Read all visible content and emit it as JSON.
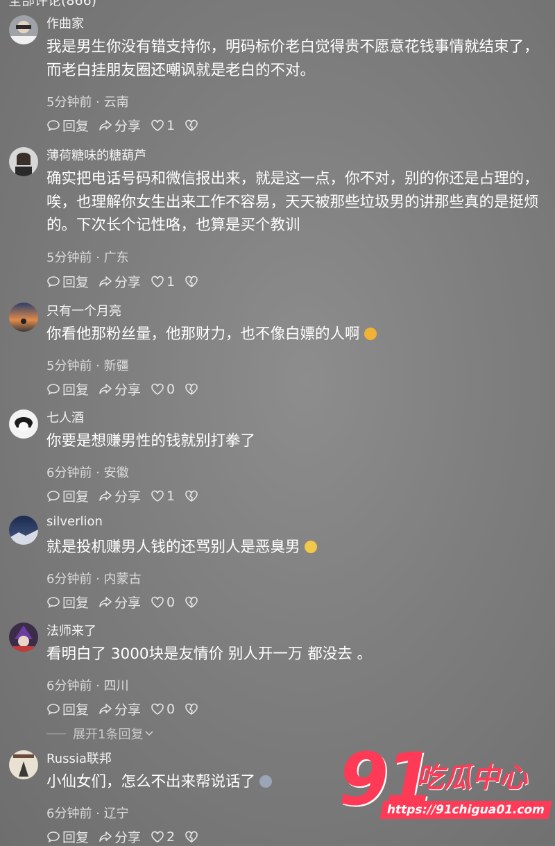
{
  "header_partial": "全部评论(866)",
  "comments": [
    {
      "username": "作曲家",
      "text": "我是男生你没有错支持你，明码标价老白觉得贵不愿意花钱事情就结束了，而老白挂朋友圈还嘲讽就是老白的不对。",
      "meta": "5分钟前 · 云南",
      "reply_label": "回复",
      "share_label": "分享",
      "likes": "1"
    },
    {
      "username": "薄荷糖味的糖葫芦",
      "text": "确实把电话号码和微信报出来，就是这一点，你不对，别的你还是占理的，唉，也理解你女生出来工作不容易，天天被那些垃圾男的讲那些真的是挺烦的。下次长个记性咯，也算是买个教训",
      "meta": "5分钟前 · 广东",
      "reply_label": "回复",
      "share_label": "分享",
      "likes": "1"
    },
    {
      "username": "只有一个月亮",
      "text": "你看他那粉丝量，他那财力，也不像白嫖的人啊",
      "meta": "5分钟前 · 新疆",
      "reply_label": "回复",
      "share_label": "分享",
      "likes": "0"
    },
    {
      "username": "七人酒",
      "text": "你要是想赚男性的钱就别打拳了",
      "meta": "6分钟前 · 安徽",
      "reply_label": "回复",
      "share_label": "分享",
      "likes": "1"
    },
    {
      "username": "silverlion",
      "text": "就是投机赚男人钱的还骂别人是恶臭男",
      "meta": "6分钟前 · 内蒙古",
      "reply_label": "回复",
      "share_label": "分享",
      "likes": "0"
    },
    {
      "username": "法师来了",
      "text": "看明白了 3000块是友情价 别人开一万 都没去 。",
      "meta": "6分钟前 · 四川",
      "reply_label": "回复",
      "share_label": "分享",
      "likes": "0"
    },
    {
      "username": "Russia联邦",
      "text": "小仙女们，怎么不出来帮说话了",
      "meta": "6分钟前 · 辽宁",
      "reply_label": "回复",
      "share_label": "分享",
      "likes": "2"
    }
  ],
  "expand_replies": "展开1条回复",
  "watermark": {
    "big": "91",
    "cn": "吃瓜中心",
    "url": "https://91chigua01.com"
  },
  "colors": {
    "watermark": "#ff3a57",
    "background": "#7e7e7e"
  },
  "icons": [
    "comment-bubble-icon",
    "share-arrow-icon",
    "heart-icon",
    "heart-broken-icon",
    "chevron-down-icon"
  ]
}
